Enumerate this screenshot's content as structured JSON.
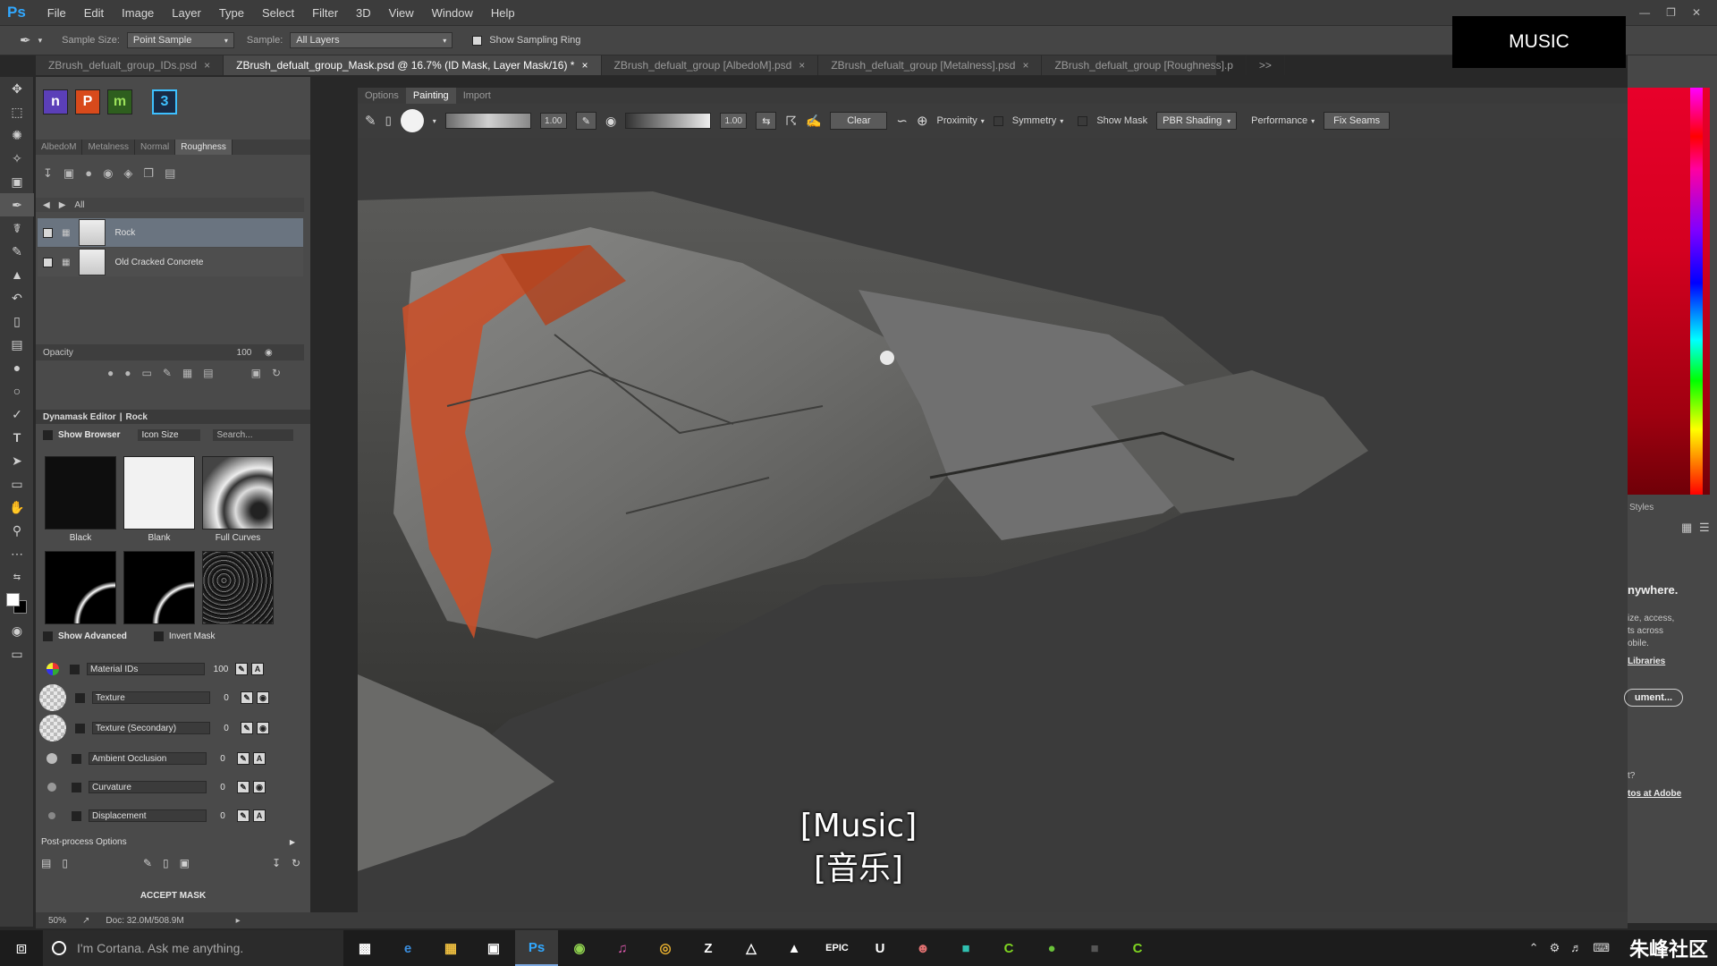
{
  "menubar": {
    "logo": "Ps",
    "items": [
      "File",
      "Edit",
      "Image",
      "Layer",
      "Type",
      "Select",
      "Filter",
      "3D",
      "View",
      "Window",
      "Help"
    ]
  },
  "optionsbar": {
    "sample_size_label": "Sample Size:",
    "sample_size_value": "Point Sample",
    "sample_label": "Sample:",
    "sample_value": "All Layers",
    "show_ring_label": "Show Sampling Ring"
  },
  "doc_tabs": [
    {
      "label": "ZBrush_defualt_group_IDs.psd",
      "active": false
    },
    {
      "label": "ZBrush_defualt_group_Mask.psd @ 16.7% (ID Mask, Layer Mask/16) *",
      "active": true
    },
    {
      "label": "ZBrush_defualt_group [AlbedoM].psd",
      "active": false
    },
    {
      "label": "ZBrush_defualt_group [Metalness].psd",
      "active": false
    },
    {
      "label": "ZBrush_defualt_group [Roughness].p",
      "active": false
    }
  ],
  "doc_tabs_more": ">>",
  "music_box": "MUSIC",
  "plugin": {
    "channel_tabs": [
      "AlbedoM",
      "Metalness",
      "Normal",
      "Roughness"
    ],
    "active_channel": "Roughness",
    "breadcrumb": "All",
    "layers": [
      {
        "name": "Rock",
        "selected": true
      },
      {
        "name": "Old Cracked Concrete",
        "selected": false
      }
    ],
    "opacity_label": "Opacity",
    "opacity_value": "100",
    "dynamask_title": "Dynamask Editor",
    "dynamask_target": "Rock",
    "show_browser": "Show Browser",
    "icon_size": "Icon Size",
    "search_placeholder": "Search...",
    "thumbs": [
      "Black",
      "Blank",
      "Full Curves"
    ],
    "show_advanced": "Show Advanced",
    "invert_mask": "Invert Mask",
    "properties": [
      {
        "name": "Material IDs",
        "value": "100"
      },
      {
        "name": "Texture",
        "value": "0"
      },
      {
        "name": "Texture (Secondary)",
        "value": "0"
      },
      {
        "name": "Ambient Occlusion",
        "value": "0"
      },
      {
        "name": "Curvature",
        "value": "0"
      },
      {
        "name": "Displacement",
        "value": "0"
      }
    ],
    "post_process": "Post-process Options",
    "accept_mask": "ACCEPT MASK"
  },
  "painter": {
    "tabs": [
      "Options",
      "Painting",
      "Import"
    ],
    "active_tab": "Painting",
    "size_value": "1.00",
    "flow_value": "1.00",
    "clear_label": "Clear",
    "proximity_label": "Proximity",
    "symmetry_label": "Symmetry",
    "show_mask_label": "Show Mask",
    "shading_value": "PBR Shading",
    "performance_label": "Performance",
    "fix_seams_label": "Fix Seams"
  },
  "caption": {
    "line1": "[Music]",
    "line2": "[音乐]"
  },
  "statusbar": {
    "zoom": "50%",
    "doc_info": "Doc: 32.0M/508.9M"
  },
  "right_panel": {
    "styles_label": "Styles",
    "promo_title": "nywhere.",
    "promo_line1": "ize, access,",
    "promo_line2": "ts across",
    "promo_line3": "obile.",
    "libraries_link": "Libraries",
    "document_button": "ument...",
    "question": "t?",
    "adobe_link": "tos at Adobe"
  },
  "taskbar": {
    "cortana_placeholder": "I'm Cortana. Ask me anything.",
    "apps": [
      "task-view",
      "edge",
      "file-explorer",
      "store",
      "photoshop",
      "substance",
      "itunes",
      "chrome",
      "zbrush",
      "keyshot",
      "photos",
      "epic-games",
      "unreal",
      "character",
      "marmoset",
      "camtasia",
      "substance-alt",
      "app-dark",
      "camtasia-alt"
    ],
    "watermark": "朱峰社区"
  },
  "colors": {
    "accent_blue": "#31a8ff",
    "orange_mask": "#c8502a",
    "taskbar": "#1c1c1c"
  }
}
